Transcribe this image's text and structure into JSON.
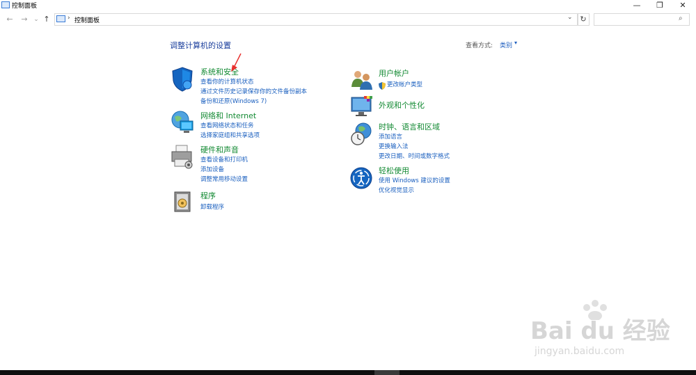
{
  "window": {
    "title": "控制面板",
    "minimize": "—",
    "restore": "❐",
    "close": "✕"
  },
  "nav": {
    "back": "←",
    "forward": "→",
    "recent": "⌄",
    "up": "↑"
  },
  "address": {
    "separator": "›",
    "path": "控制面板",
    "dropdown": "⌄",
    "refresh": "↻"
  },
  "search": {
    "placeholder": "",
    "icon": "⌕"
  },
  "header": {
    "title": "调整计算机的设置",
    "view_label": "查看方式:",
    "view_value": "类别",
    "view_caret": "▾"
  },
  "categories": {
    "system": {
      "title": "系统和安全",
      "links": [
        "查看你的计算机状态",
        "通过文件历史记录保存你的文件备份副本",
        "备份和还原(Windows 7)"
      ]
    },
    "network": {
      "title": "网络和 Internet",
      "links": [
        "查看网络状态和任务",
        "选择家庭组和共享选项"
      ]
    },
    "hardware": {
      "title": "硬件和声音",
      "links": [
        "查看设备和打印机",
        "添加设备",
        "调整常用移动设置"
      ]
    },
    "programs": {
      "title": "程序",
      "links": [
        "卸载程序"
      ]
    },
    "user": {
      "title": "用户帐户",
      "links": [
        "更改帐户类型"
      ]
    },
    "appearance": {
      "title": "外观和个性化",
      "links": []
    },
    "clock": {
      "title": "时钟、语言和区域",
      "links": [
        "添加语言",
        "更换输入法",
        "更改日期、时间或数字格式"
      ]
    },
    "ease": {
      "title": "轻松使用",
      "links": [
        "使用 Windows 建议的设置",
        "优化视觉显示"
      ]
    }
  },
  "watermark": {
    "brand": "Bai du 经验",
    "url": "jingyan.baidu.com"
  },
  "colors": {
    "category_title": "#138a33",
    "link": "#1a5fbf",
    "page_title": "#1a3e9c",
    "annotation_arrow": "#e8312f"
  }
}
